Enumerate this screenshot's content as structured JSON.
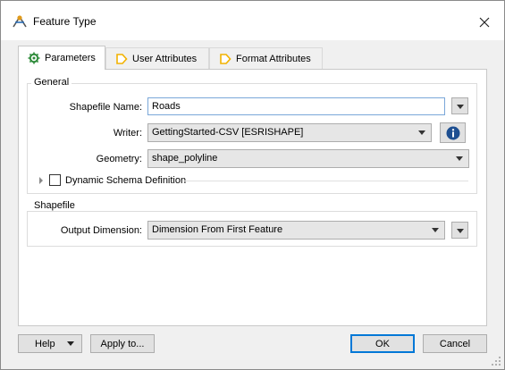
{
  "window": {
    "title": "Feature Type"
  },
  "tabs": [
    {
      "label": "Parameters",
      "active": true,
      "icon": "gear-icon"
    },
    {
      "label": "User Attributes",
      "active": false,
      "icon": "tag-arrow-icon"
    },
    {
      "label": "Format Attributes",
      "active": false,
      "icon": "tag-arrow-icon"
    }
  ],
  "general": {
    "title": "General",
    "shapefile_name_label": "Shapefile Name:",
    "shapefile_name_value": "Roads",
    "writer_label": "Writer:",
    "writer_value": "GettingStarted-CSV [ESRISHAPE]",
    "geometry_label": "Geometry:",
    "geometry_value": "shape_polyline",
    "dynamic_schema_label": "Dynamic Schema Definition",
    "dynamic_schema_checked": false
  },
  "shapefile": {
    "title": "Shapefile",
    "output_dimension_label": "Output Dimension:",
    "output_dimension_value": "Dimension From First Feature"
  },
  "footer": {
    "help_label": "Help",
    "apply_label": "Apply to...",
    "ok_label": "OK",
    "cancel_label": "Cancel"
  },
  "colors": {
    "accent": "#0078d7",
    "info_icon": "#1e4f91",
    "tab_icon": "#f2b200"
  }
}
